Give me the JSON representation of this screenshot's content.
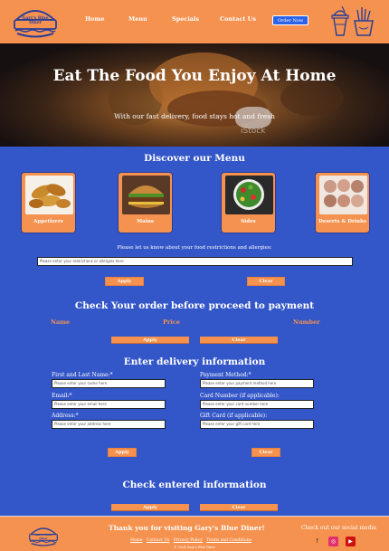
{
  "header": {
    "logo_text": "Gary's Blue Diner",
    "nav": [
      "Home",
      "Menu",
      "Specials",
      "Contact Us"
    ],
    "order_button": "Order Now",
    "icons": [
      "milkshake-icon",
      "fries-icon"
    ],
    "bg_color": "#f5924f"
  },
  "hero": {
    "title": "Eat The Food You Enjoy At Home",
    "subtitle": "With our fast delivery, food stays hot and fresh",
    "watermark": "iStock"
  },
  "menu": {
    "title": "Discover our Menu",
    "cards": [
      {
        "label": "Appetizers",
        "icon": "chicken-tenders-image"
      },
      {
        "label": "Mains",
        "icon": "burger-image"
      },
      {
        "label": "Sides",
        "icon": "salad-image"
      },
      {
        "label": "Deserts & Drinks",
        "icon": "desserts-image"
      }
    ],
    "allergy_note": "Please let us know about your food restrictions and allergies:",
    "allergy_placeholder": "Please enter your restrictions or allergies here",
    "apply": "Apply",
    "clear": "Clear"
  },
  "order": {
    "title": "Check Your order before proceed to payment",
    "columns": [
      "Name",
      "Price",
      "Number"
    ],
    "apply": "Apply",
    "clear": "Clear"
  },
  "delivery": {
    "title": "Enter delivery information",
    "name_label": "First and Last Name:*",
    "name_placeholder": "Please enter your name here",
    "email_label": "Email:*",
    "email_placeholder": "Please enter your email here",
    "address_label": "Address:*",
    "address_placeholder": "Please enter your address here",
    "payment_label": "Payment Method:*",
    "payment_placeholder": "Please enter your payment method here",
    "card_label": "Card Number (if applicable):",
    "card_placeholder": "Please enter your card number here",
    "gift_label": "Gift Card (if applicable):",
    "gift_placeholder": "Please enter your gift card here",
    "apply": "Apply",
    "clear": "Clear"
  },
  "check": {
    "title": "Check entered information",
    "apply": "Apply",
    "clear": "Clear"
  },
  "footer": {
    "logo_text": "Gary's Blue Diner",
    "thanks": "Thank you for visiting Gary's Blue Diner!",
    "links": [
      "Home",
      "Contact Us",
      "Privacy Policy",
      "Terms and Conditions"
    ],
    "copyright": "© 2024 Gary's Blue Diner",
    "social_title": "Check out our social media",
    "social": [
      {
        "name": "facebook-icon",
        "glyph": "f",
        "color": "#3a3a3a"
      },
      {
        "name": "instagram-icon",
        "glyph": "◎",
        "color": "#e1306c"
      },
      {
        "name": "youtube-icon",
        "glyph": "▶",
        "color": "#cc1111"
      }
    ]
  }
}
